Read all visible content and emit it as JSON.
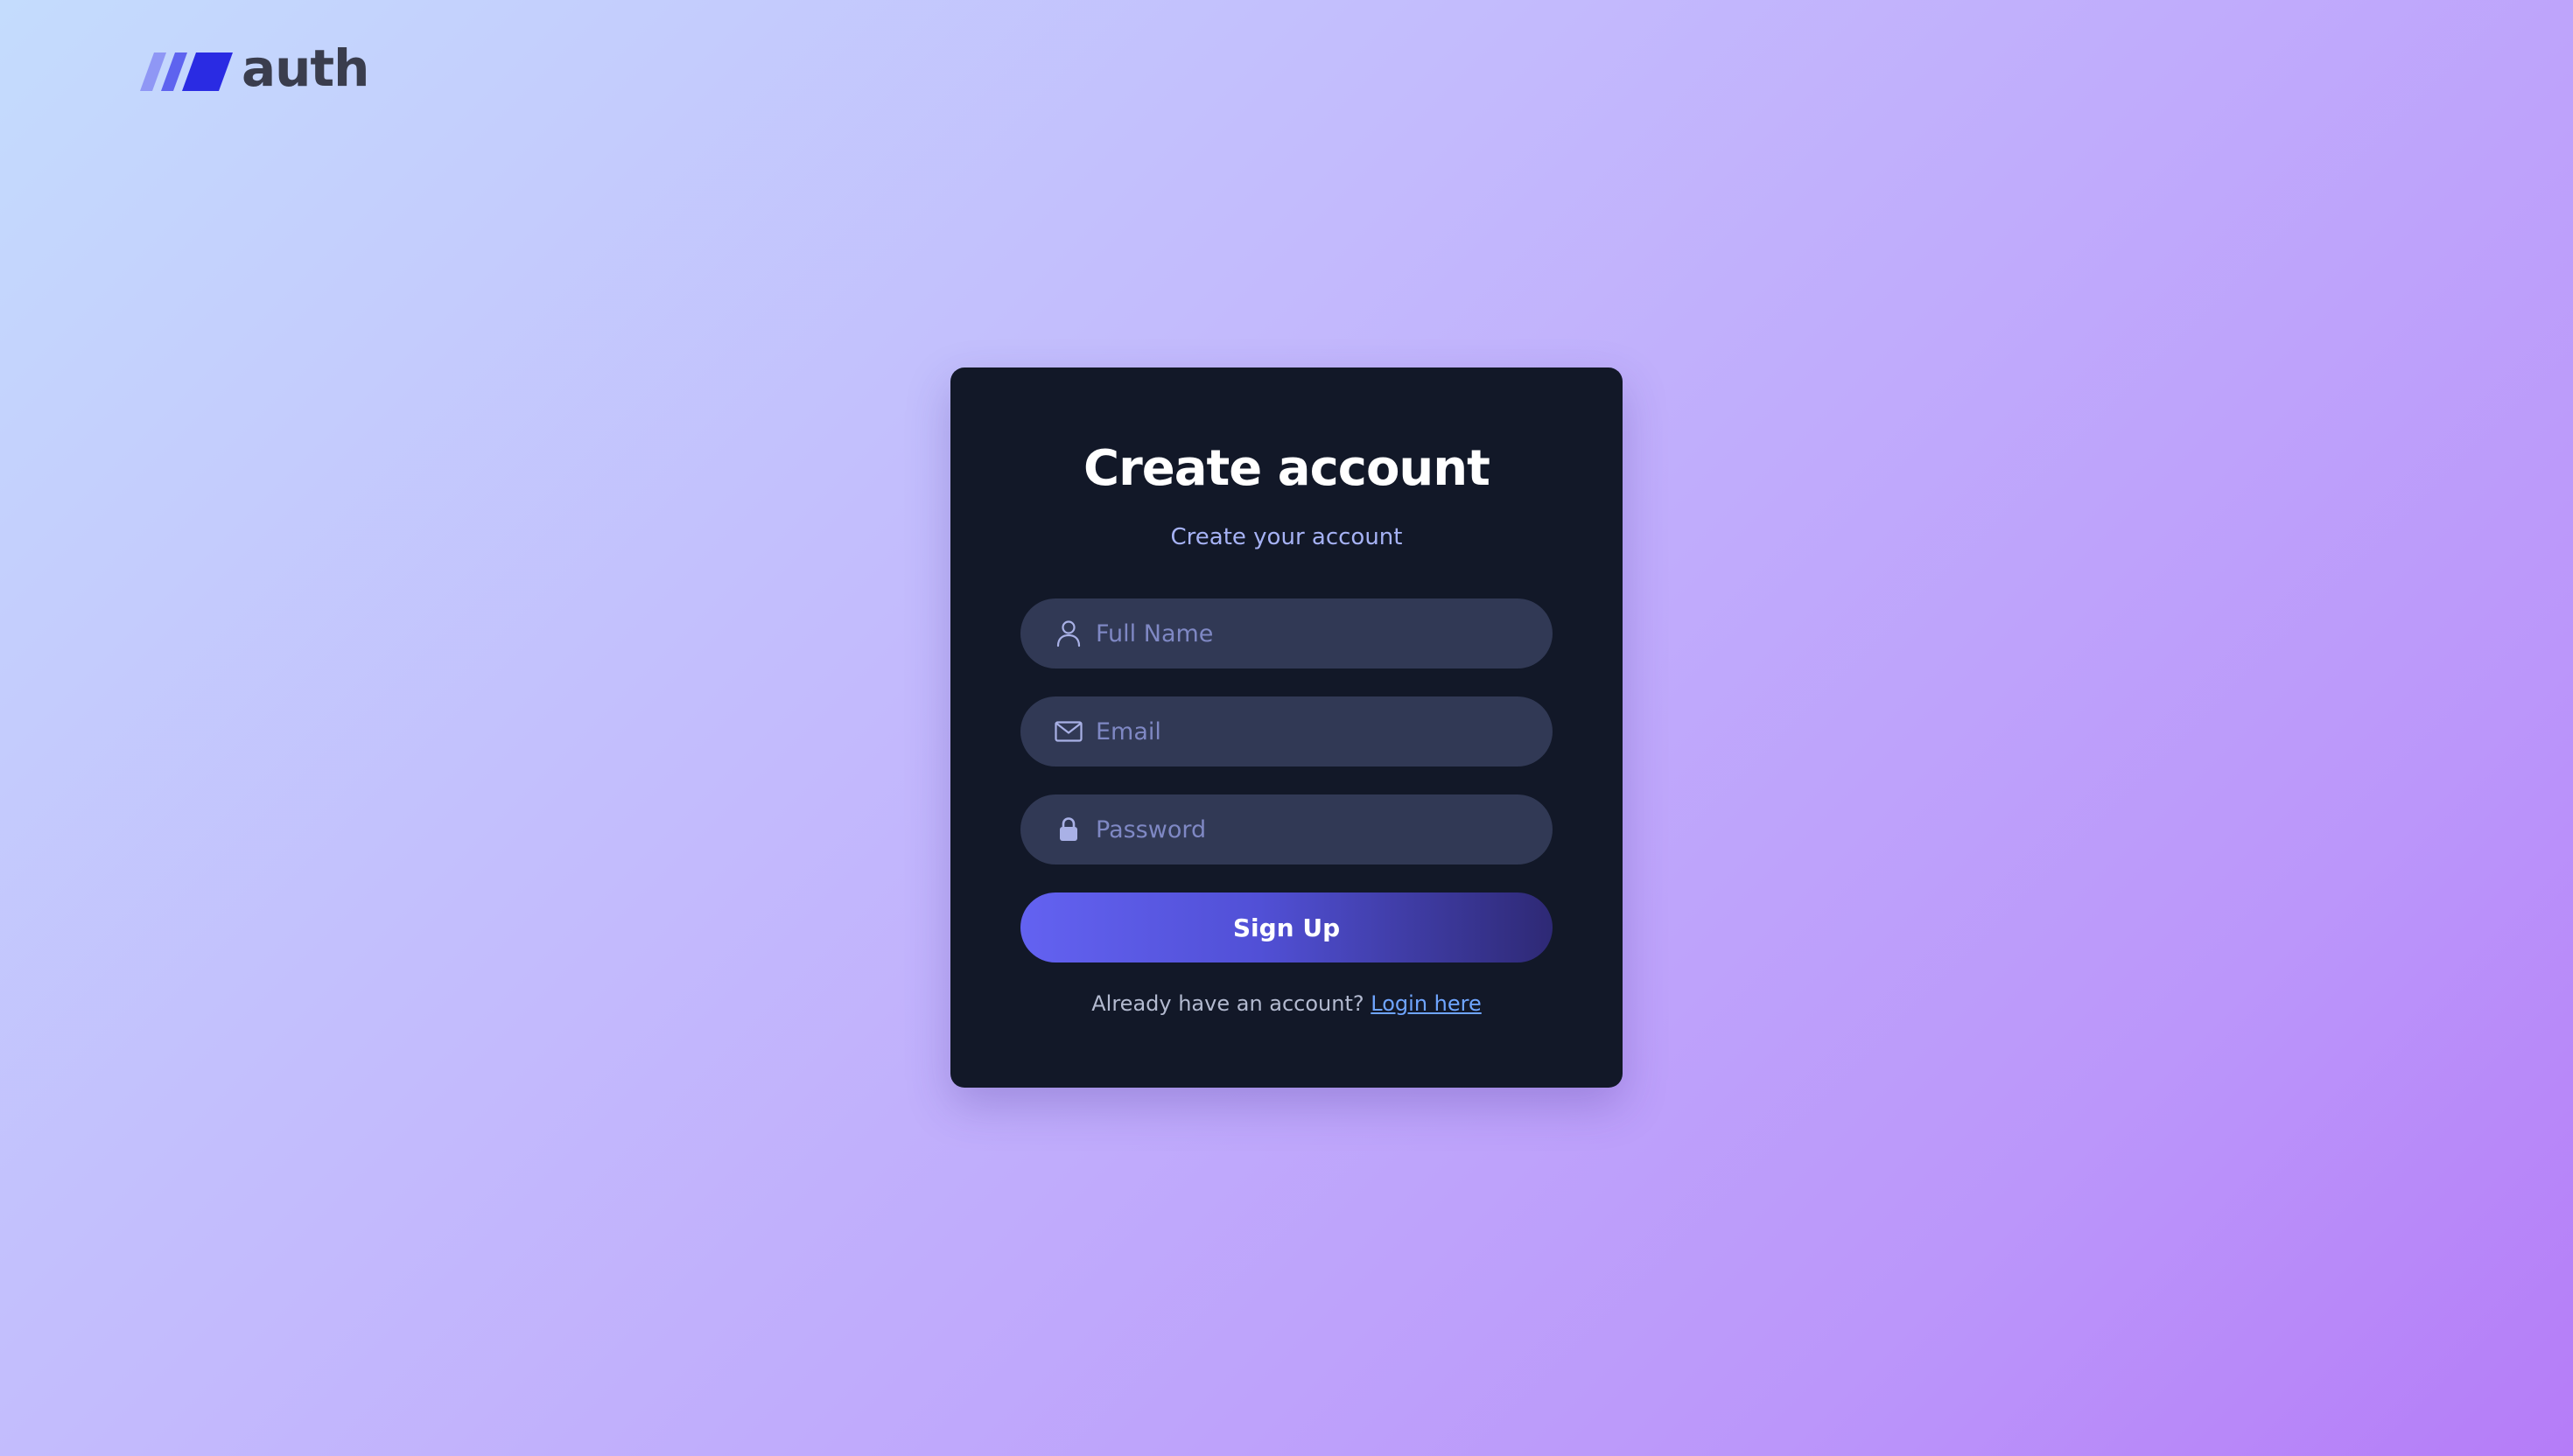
{
  "brand": {
    "name": "auth",
    "colors": [
      "#8f97f5",
      "#5e63ef",
      "#2a2be3"
    ]
  },
  "card": {
    "title": "Create account",
    "subtitle": "Create your account",
    "fields": {
      "full_name": {
        "placeholder": "Full Name",
        "value": "",
        "icon": "user-icon"
      },
      "email": {
        "placeholder": "Email",
        "value": "",
        "icon": "mail-icon"
      },
      "password": {
        "placeholder": "Password",
        "value": "",
        "icon": "lock-icon"
      }
    },
    "submit_label": "Sign Up",
    "footer": {
      "prompt": "Already have an account?",
      "link_label": "Login here"
    }
  },
  "colors": {
    "card_bg": "#121828",
    "input_bg": "#313955",
    "accent": "#6362f1",
    "link": "#6fa5ff"
  }
}
